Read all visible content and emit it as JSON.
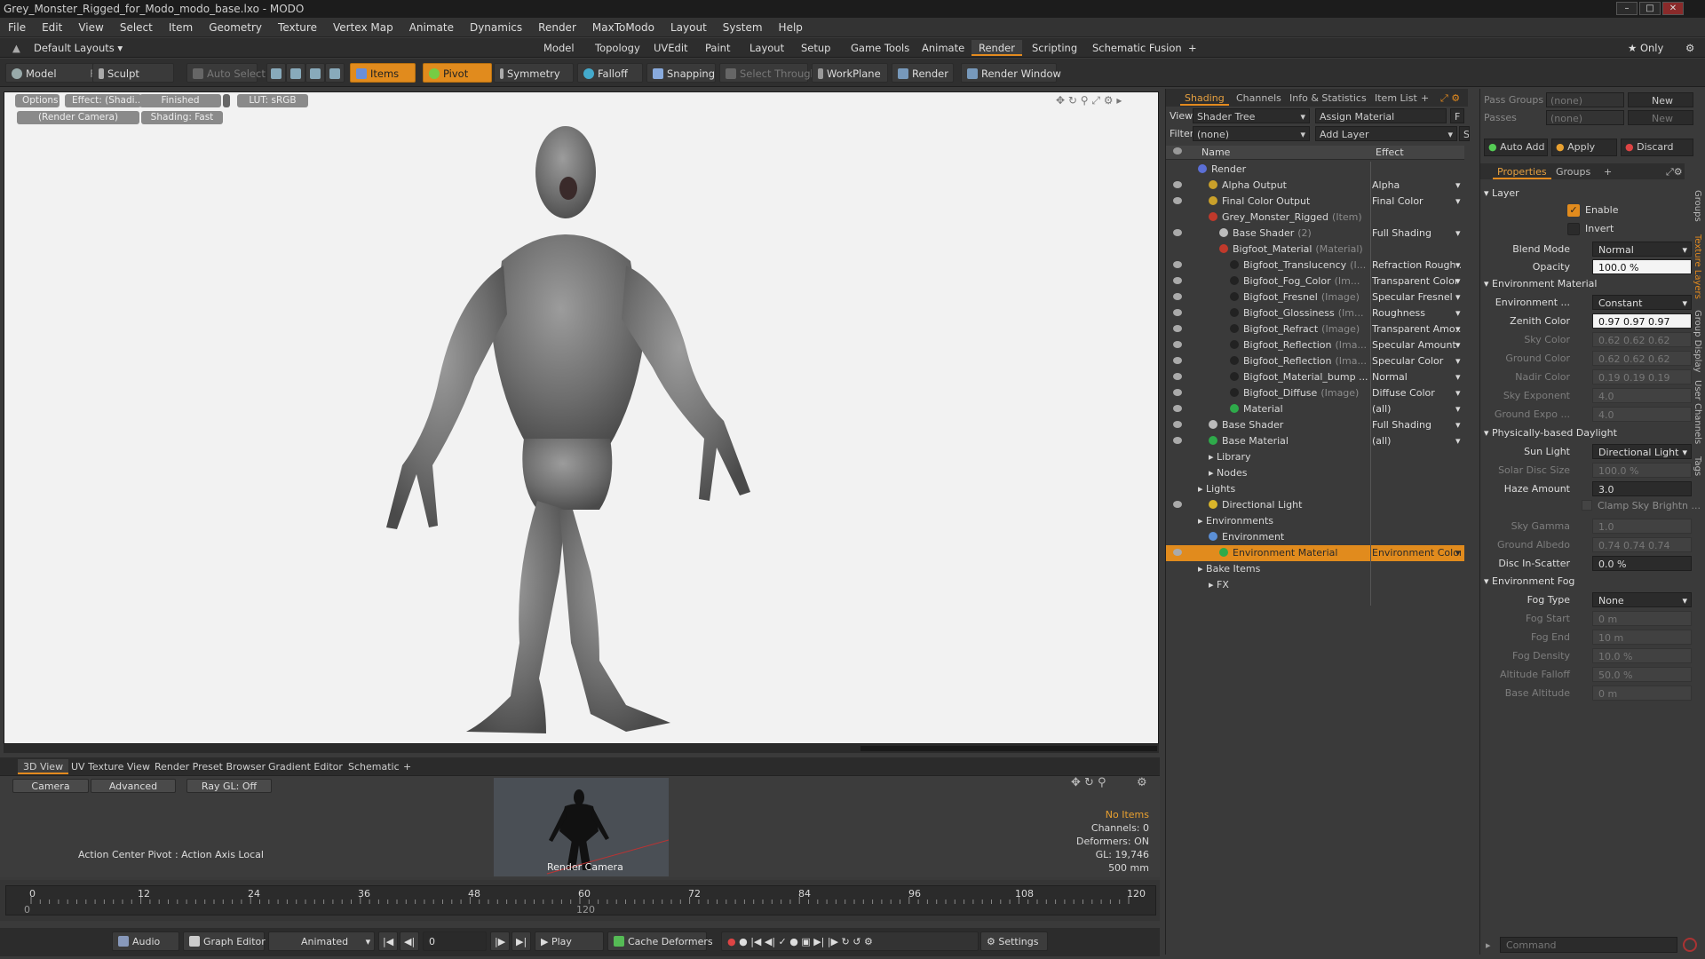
{
  "window": {
    "title": "Grey_Monster_Rigged_for_Modo_modo_base.lxo - MODO"
  },
  "menu": [
    "File",
    "Edit",
    "View",
    "Select",
    "Item",
    "Geometry",
    "Texture",
    "Vertex Map",
    "Animate",
    "Dynamics",
    "Render",
    "MaxToModo",
    "Layout",
    "System",
    "Help"
  ],
  "layout_selector": "Default Layouts ▾",
  "layout_tabs": [
    "Model",
    "Topology",
    "UVEdit",
    "Paint",
    "Layout",
    "Setup",
    "Game Tools",
    "Animate",
    "Render",
    "Scripting",
    "Schematic Fusion",
    "+"
  ],
  "only_label": "★ Only",
  "toolbar": {
    "model": "Model",
    "model_key": "F2",
    "sculpt": "Sculpt",
    "auto_select": "Auto Select",
    "items": "Items",
    "pivot": "Pivot",
    "symmetry": "Symmetry",
    "falloff": "Falloff",
    "snapping": "Snapping",
    "select_through": "Select Through",
    "workplane": "WorkPlane",
    "render": "Render",
    "render_window": "Render Window"
  },
  "viewport": {
    "pills": [
      "Options",
      "Effect: (Shadi...",
      "Finished",
      "LUT: sRGB",
      "(Render Camera)",
      "Shading: Fast"
    ]
  },
  "bottom_tabs": [
    "3D View",
    "UV Texture View",
    "Render Preset Browser",
    "Gradient Editor",
    "Schematic",
    "+"
  ],
  "small3d": {
    "camera": "Camera",
    "advanced": "Advanced",
    "raygl": "Ray GL: Off",
    "action_center": "Action Center Pivot : Action Axis Local",
    "thumb_label": "Render Camera",
    "stats": [
      "No Items",
      "Channels: 0",
      "Deformers: ON",
      "GL: 19,746",
      "500 mm"
    ]
  },
  "timeline": {
    "ticks": [
      "0",
      "12",
      "24",
      "36",
      "48",
      "60",
      "72",
      "84",
      "96",
      "108",
      "120"
    ],
    "sub_ticks": [
      "0",
      "120"
    ]
  },
  "playbar": {
    "audio": "Audio",
    "graph_editor": "Graph Editor",
    "animated": "Animated",
    "frame": "0",
    "play": "Play",
    "cache_deformers": "Cache Deformers",
    "settings": "Settings"
  },
  "shading": {
    "tabs": [
      "Shading",
      "Channels",
      "Info & Statistics",
      "Item List",
      "+"
    ],
    "view_label": "View",
    "view_value": "Shader Tree",
    "assign_material": "Assign Material",
    "f_btn": "F",
    "filter_label": "Filter",
    "filter_value": "(none)",
    "add_layer": "Add Layer",
    "s_btn": "S",
    "col_name": "Name",
    "col_effect": "Effect",
    "rows": [
      {
        "name": "Render",
        "suffix": "",
        "effect": "",
        "indent": 0,
        "icon": "#5b6fd6"
      },
      {
        "name": "Alpha Output",
        "suffix": "",
        "effect": "Alpha",
        "indent": 1,
        "icon": "#c9a02a"
      },
      {
        "name": "Final Color Output",
        "suffix": "",
        "effect": "Final Color",
        "indent": 1,
        "icon": "#c9a02a"
      },
      {
        "name": "Grey_Monster_Rigged",
        "suffix": "(Item)",
        "effect": "",
        "indent": 1,
        "icon": "#c0392b"
      },
      {
        "name": "Base Shader",
        "suffix": "(2)",
        "effect": "Full Shading",
        "indent": 2,
        "icon": "#bbbbbb"
      },
      {
        "name": "Bigfoot_Material",
        "suffix": "(Material)",
        "effect": "",
        "indent": 2,
        "icon": "#c0392b"
      },
      {
        "name": "Bigfoot_Translucency",
        "suffix": "(I...",
        "effect": "Refraction Rough ...",
        "indent": 3,
        "icon": "#222222"
      },
      {
        "name": "Bigfoot_Fog_Color",
        "suffix": "(Im...",
        "effect": "Transparent Color",
        "indent": 3,
        "icon": "#222222"
      },
      {
        "name": "Bigfoot_Fresnel",
        "suffix": "(Image)",
        "effect": "Specular Fresnel",
        "indent": 3,
        "icon": "#222222"
      },
      {
        "name": "Bigfoot_Glossiness",
        "suffix": "(Im...",
        "effect": "Roughness",
        "indent": 3,
        "icon": "#222222"
      },
      {
        "name": "Bigfoot_Refract",
        "suffix": "(Image)",
        "effect": "Transparent Amo...",
        "indent": 3,
        "icon": "#222222"
      },
      {
        "name": "Bigfoot_Reflection",
        "suffix": "(Ima...",
        "effect": "Specular Amount",
        "indent": 3,
        "icon": "#222222"
      },
      {
        "name": "Bigfoot_Reflection",
        "suffix": "(Ima...",
        "effect": "Specular Color",
        "indent": 3,
        "icon": "#222222"
      },
      {
        "name": "Bigfoot_Material_bump ...",
        "suffix": "",
        "effect": "Normal",
        "indent": 3,
        "icon": "#222222"
      },
      {
        "name": "Bigfoot_Diffuse",
        "suffix": "(Image)",
        "effect": "Diffuse Color",
        "indent": 3,
        "icon": "#222222"
      },
      {
        "name": "Material",
        "suffix": "",
        "effect": "(all)",
        "indent": 3,
        "icon": "#2eaa4a"
      },
      {
        "name": "Base Shader",
        "suffix": "",
        "effect": "Full Shading",
        "indent": 1,
        "icon": "#bbbbbb"
      },
      {
        "name": "Base Material",
        "suffix": "",
        "effect": "(all)",
        "indent": 1,
        "icon": "#2eaa4a"
      },
      {
        "name": "Library",
        "suffix": "",
        "effect": "",
        "indent": 1,
        "icon": ""
      },
      {
        "name": "Nodes",
        "suffix": "",
        "effect": "",
        "indent": 1,
        "icon": ""
      },
      {
        "name": "Lights",
        "suffix": "",
        "effect": "",
        "indent": 0,
        "icon": ""
      },
      {
        "name": "Directional Light",
        "suffix": "",
        "effect": "",
        "indent": 1,
        "icon": "#d9b52a"
      },
      {
        "name": "Environments",
        "suffix": "",
        "effect": "",
        "indent": 0,
        "icon": ""
      },
      {
        "name": "Environment",
        "suffix": "",
        "effect": "",
        "indent": 1,
        "icon": "#5b8fd6"
      },
      {
        "name": "Environment Material",
        "suffix": "",
        "effect": "Environment Color",
        "indent": 2,
        "icon": "#2eaa4a",
        "selected": true
      },
      {
        "name": "Bake Items",
        "suffix": "",
        "effect": "",
        "indent": 0,
        "icon": ""
      },
      {
        "name": "FX",
        "suffix": "",
        "effect": "",
        "indent": 1,
        "icon": ""
      }
    ]
  },
  "props": {
    "pass_groups_label": "Pass Groups",
    "pass_groups_value": "(none)",
    "new1": "New",
    "passes_label": "Passes",
    "passes_value": "(none)",
    "new2": "New",
    "auto_add": "Auto Add",
    "apply": "Apply",
    "discard": "Discard",
    "tabs": [
      "Properties",
      "Groups",
      "+"
    ],
    "layer_section": "Layer",
    "enable": "Enable",
    "invert": "Invert",
    "blend_mode_label": "Blend Mode",
    "blend_mode": "Normal",
    "opacity_label": "Opacity",
    "opacity": "100.0 %",
    "env_mat_section": "Environment Material",
    "environment_label": "Environment ...",
    "environment": "Constant",
    "zenith_label": "Zenith Color",
    "zenith": "0.97   0.97   0.97",
    "sky_label": "Sky Color",
    "sky": "0.62   0.62   0.62",
    "ground_label": "Ground Color",
    "ground": "0.62   0.62   0.62",
    "nadir_label": "Nadir Color",
    "nadir": "0.19   0.19   0.19",
    "sky_exp_label": "Sky Exponent",
    "sky_exp": "4.0",
    "ground_exp_label": "Ground Expo ...",
    "ground_exp": "4.0",
    "daylight_section": "Physically-based Daylight",
    "sun_light_label": "Sun Light",
    "sun_light": "Directional Light",
    "solar_disc_label": "Solar Disc Size",
    "solar_disc": "100.0 %",
    "haze_label": "Haze Amount",
    "haze": "3.0",
    "clamp_label": "Clamp Sky Brightn ...",
    "sky_gamma_label": "Sky Gamma",
    "sky_gamma": "1.0",
    "ground_albedo_label": "Ground Albedo",
    "ground_albedo": "0.74   0.74   0.74",
    "disc_in_label": "Disc In-Scatter",
    "disc_in": "0.0 %",
    "fog_section": "Environment Fog",
    "fog_type_label": "Fog Type",
    "fog_type": "None",
    "fog_start_label": "Fog Start",
    "fog_start": "0 m",
    "fog_end_label": "Fog End",
    "fog_end": "10 m",
    "fog_density_label": "Fog Density",
    "fog_density": "10.0 %",
    "alt_falloff_label": "Altitude Falloff",
    "alt_falloff": "50.0 %",
    "base_alt_label": "Base Altitude",
    "base_alt": "0 m",
    "vtabs": [
      "Groups",
      "Texture Layers",
      "Group Display",
      "User Channels",
      "Tags"
    ],
    "command_placeholder": "Command"
  }
}
